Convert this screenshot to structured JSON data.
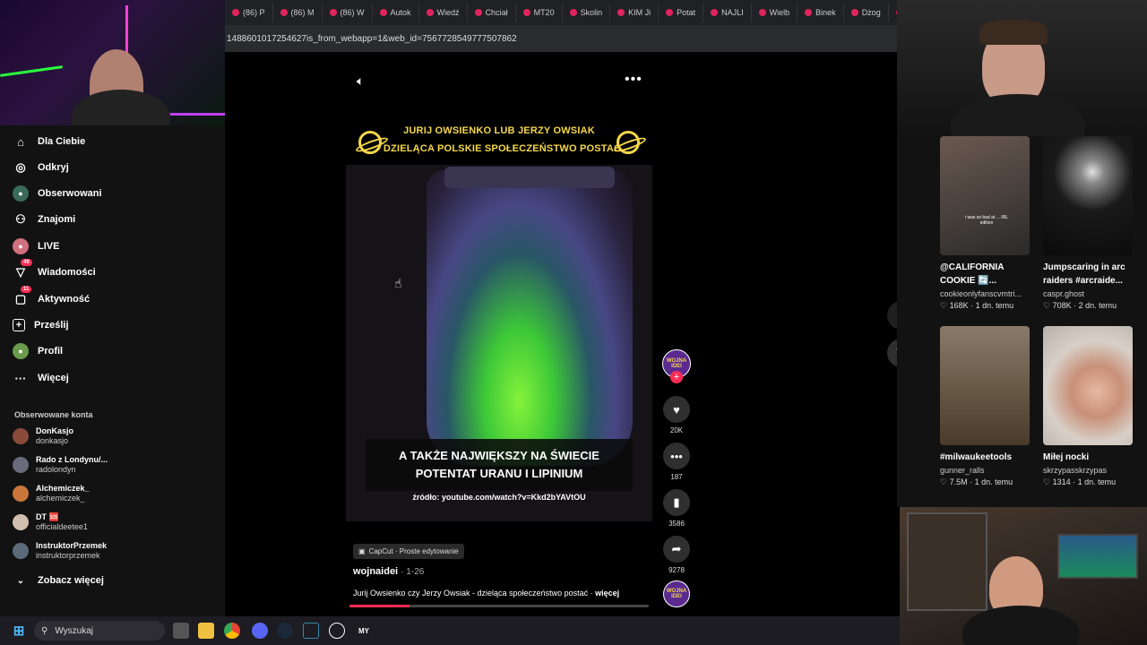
{
  "browser": {
    "tabs": [
      "(86) P",
      "(86) M",
      "(86) W",
      "Autok",
      "Wiedź",
      "Chciał",
      "MT20",
      "Skolin",
      "KIM Ji",
      "Potat",
      "NAJLI",
      "Wielb",
      "Binek",
      "Dżog",
      "C"
    ],
    "url": "1488601017254627is_from_webapp=1&web_id=7567728549777507862"
  },
  "sidebar": {
    "nav": [
      {
        "label": "Dla Ciebie",
        "icon": "home-icon",
        "badge": ""
      },
      {
        "label": "Odkryj",
        "icon": "compass-icon",
        "badge": ""
      },
      {
        "label": "Obserwowani",
        "icon": "following-icon",
        "badge": ""
      },
      {
        "label": "Znajomi",
        "icon": "friends-icon",
        "badge": ""
      },
      {
        "label": "LIVE",
        "icon": "live-icon",
        "badge": ""
      },
      {
        "label": "Wiadomości",
        "icon": "messages-icon",
        "badge": "49"
      },
      {
        "label": "Aktywność",
        "icon": "activity-icon",
        "badge": "11"
      },
      {
        "label": "Prześlij",
        "icon": "upload-icon",
        "badge": ""
      },
      {
        "label": "Profil",
        "icon": "profile-icon",
        "badge": ""
      },
      {
        "label": "Więcej",
        "icon": "more-icon",
        "badge": ""
      }
    ],
    "followed_title": "Obserwowane konta",
    "accounts": [
      {
        "name": "DonKasjo",
        "handle": "donkasjo",
        "color": "#8a4a3a"
      },
      {
        "name": "Rado z Londynu/...",
        "handle": "radolondyn",
        "color": "#6a6a7a"
      },
      {
        "name": "Alchemiczek_",
        "handle": "alchemiczek_",
        "color": "#c8763a"
      },
      {
        "name": "DT 🆘",
        "handle": "officialdeetee1",
        "color": "#d0c0b0"
      },
      {
        "name": "InstruktorPrzemek",
        "handle": "instruktorprzemek",
        "color": "#5a6a7a"
      }
    ],
    "see_more": "Zobacz więcej"
  },
  "video": {
    "title_line1": "JURIJ OWSIENKO LUB JERZY OWSIAK",
    "title_line2": "- DZIELĄCA POLSKIE SPOŁECZEŃSTWO POSTAĆ",
    "caption": "A TAKŻE NAJWIĘKSZY NA ŚWIECIE POTENTAT URANU I LIPINIUM",
    "source": "źródło: youtube.com/watch?v=Kkd2bYAVtOU",
    "progress": 0.2
  },
  "actions": {
    "avatar_label": "WOJNA IDEI",
    "likes": "20K",
    "comments": "187",
    "saves": "3586",
    "shares": "9278"
  },
  "post": {
    "capcut": "CapCut · Proste edytowanie",
    "author": "wojnaidei",
    "date": "· 1-26",
    "description": "Jurij Owsienko czy Jerzy Owsiak - dzieląca społeczeństwo postać ·",
    "more": "więcej"
  },
  "recommended": [
    {
      "title": "@CALIFORNIA COOKIE 🔄...",
      "user": "cookieonlyfanscvmtri...",
      "likes": "168K",
      "age": "1 dn. temu",
      "overlay": "i was so bad at ... IRL edition"
    },
    {
      "title": "Jumpscaring in arc raiders #arcraide...",
      "user": "caspr.ghost",
      "likes": "708K",
      "age": "2 dn. temu",
      "overlay": ""
    },
    {
      "title": "#milwaukeetools",
      "user": "gunner_ralls",
      "likes": "7.5M",
      "age": "1 dn. temu",
      "overlay": ""
    },
    {
      "title": "Miłej nocki",
      "user": "skrzypasskrzypas",
      "likes": "1314",
      "age": "1 dn. temu",
      "overlay": ""
    }
  ],
  "taskbar": {
    "search": "Wyszukaj",
    "app_label": "MY"
  },
  "colors": {
    "accent": "#fe2c55",
    "bg": "#121212",
    "title_yellow": "#f5d74a"
  }
}
